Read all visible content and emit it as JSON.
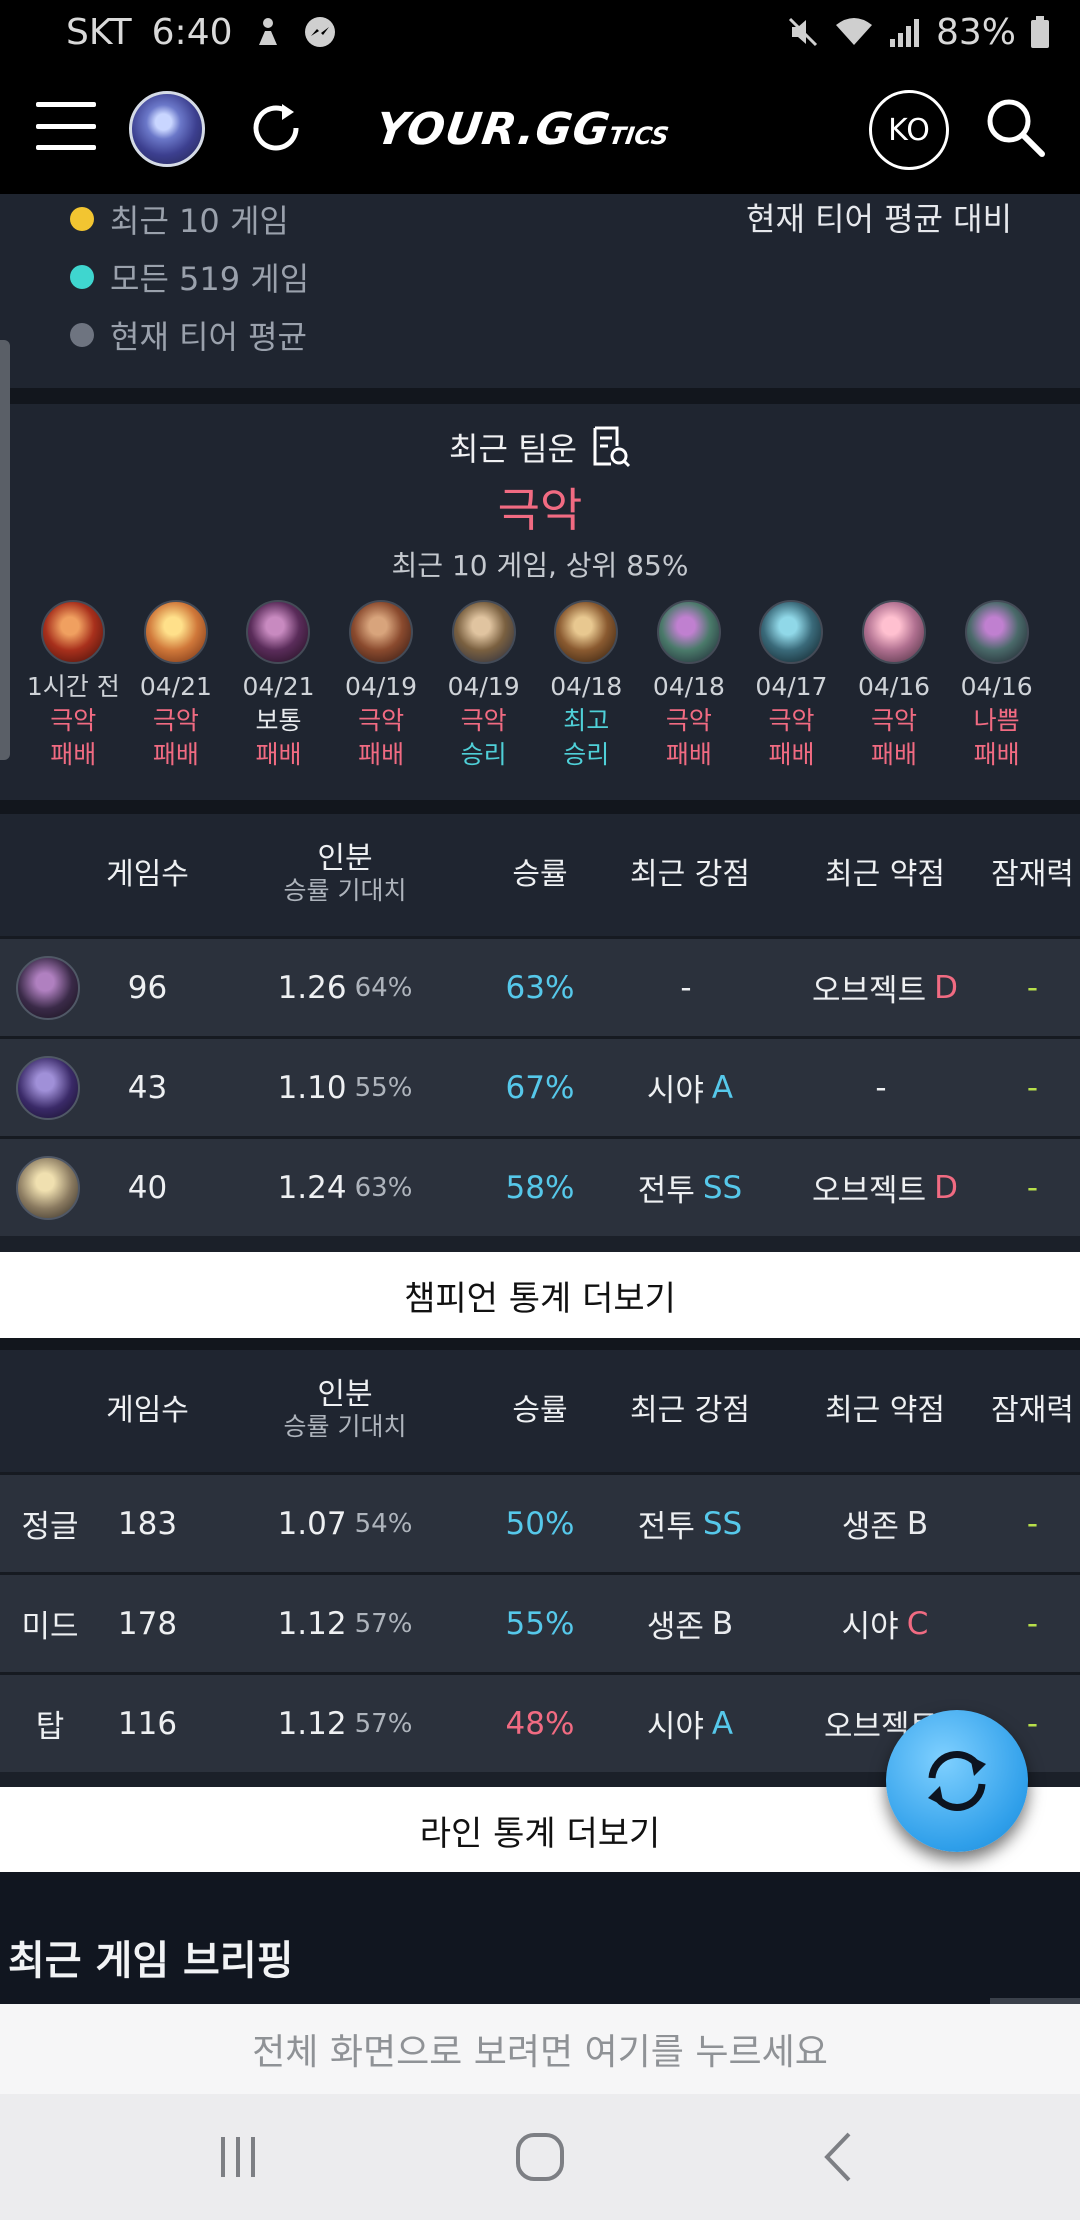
{
  "status_bar": {
    "carrier": "SKT",
    "time": "6:40",
    "battery": "83%"
  },
  "header": {
    "logo_main": "YOUR.GG",
    "logo_suffix": "TICS",
    "lang": "KO"
  },
  "legend": {
    "items": [
      {
        "label": "최근 10 게임",
        "color": "#f2c531"
      },
      {
        "label": "모든 519 게임",
        "color": "#3fd6cf"
      },
      {
        "label": "현재 티어 평균",
        "color": "#6e7480"
      }
    ],
    "compare_label": "현재 티어 평균 대비"
  },
  "team_luck": {
    "title": "최근 팀운",
    "result": "극악",
    "summary": "최근 10 게임, 상위 85%",
    "games": [
      {
        "date": "1시간 전",
        "luck": "극악",
        "luck_color": "red",
        "result": "패배",
        "result_color": "red",
        "icon": "champion-icon-1"
      },
      {
        "date": "04/21",
        "luck": "극악",
        "luck_color": "red",
        "result": "패배",
        "result_color": "red",
        "icon": "champion-icon-2"
      },
      {
        "date": "04/21",
        "luck": "보통",
        "luck_color": "white",
        "result": "패배",
        "result_color": "red",
        "icon": "champion-icon-3"
      },
      {
        "date": "04/19",
        "luck": "극악",
        "luck_color": "red",
        "result": "패배",
        "result_color": "red",
        "icon": "champion-icon-4"
      },
      {
        "date": "04/19",
        "luck": "극악",
        "luck_color": "red",
        "result": "승리",
        "result_color": "cyan",
        "icon": "champion-icon-5"
      },
      {
        "date": "04/18",
        "luck": "최고",
        "luck_color": "cyan",
        "result": "승리",
        "result_color": "cyan",
        "icon": "champion-icon-6"
      },
      {
        "date": "04/18",
        "luck": "극악",
        "luck_color": "red",
        "result": "패배",
        "result_color": "red",
        "icon": "champion-icon-7"
      },
      {
        "date": "04/17",
        "luck": "극악",
        "luck_color": "red",
        "result": "패배",
        "result_color": "red",
        "icon": "champion-icon-8"
      },
      {
        "date": "04/16",
        "luck": "극악",
        "luck_color": "red",
        "result": "패배",
        "result_color": "red",
        "icon": "champion-icon-9"
      },
      {
        "date": "04/16",
        "luck": "나쁨",
        "luck_color": "red",
        "result": "패배",
        "result_color": "red",
        "icon": "champion-icon-10"
      }
    ]
  },
  "table_headers": {
    "games": "게임수",
    "perf": "인분",
    "perf_sub": "승률 기대치",
    "winrate": "승률",
    "strength": "최근 강점",
    "weakness": "최근 약점",
    "potential": "잠재력"
  },
  "champion_stats": {
    "rows": [
      {
        "icon": "champion-icon-akali",
        "games": "96",
        "perf": "1.26",
        "perf_pct": "64%",
        "winrate": "63%",
        "winrate_color": "blue",
        "strength": "-",
        "strength_grade": "",
        "weakness": "오브젝트",
        "weakness_grade": "D",
        "potential": "-"
      },
      {
        "icon": "champion-icon-kassadin",
        "games": "43",
        "perf": "1.10",
        "perf_pct": "55%",
        "winrate": "67%",
        "winrate_color": "blue",
        "strength": "시야",
        "strength_grade": "A",
        "weakness": "-",
        "weakness_grade": "",
        "potential": "-"
      },
      {
        "icon": "champion-icon-3",
        "games": "40",
        "perf": "1.24",
        "perf_pct": "63%",
        "winrate": "58%",
        "winrate_color": "blue",
        "strength": "전투",
        "strength_grade": "SS",
        "weakness": "오브젝트",
        "weakness_grade": "D",
        "potential": "-"
      }
    ],
    "more_label": "챔피언 통계 더보기"
  },
  "lane_stats": {
    "rows": [
      {
        "lane": "정글",
        "games": "183",
        "perf": "1.07",
        "perf_pct": "54%",
        "winrate": "50%",
        "winrate_color": "blue",
        "strength": "전투",
        "strength_grade": "SS",
        "strength_grade_color": "blue",
        "weakness": "생존",
        "weakness_grade": "B",
        "weakness_grade_color": "white",
        "potential": "-"
      },
      {
        "lane": "미드",
        "games": "178",
        "perf": "1.12",
        "perf_pct": "57%",
        "winrate": "55%",
        "winrate_color": "blue",
        "strength": "생존",
        "strength_grade": "B",
        "strength_grade_color": "white",
        "weakness": "시야",
        "weakness_grade": "C",
        "weakness_grade_color": "red",
        "potential": "-"
      },
      {
        "lane": "탑",
        "games": "116",
        "perf": "1.12",
        "perf_pct": "57%",
        "winrate": "48%",
        "winrate_color": "red",
        "strength": "시야",
        "strength_grade": "A",
        "strength_grade_color": "blue",
        "weakness": "오브젝트",
        "weakness_grade": "",
        "weakness_grade_color": "red",
        "potential": "-"
      }
    ],
    "more_label": "라인 통계 더보기"
  },
  "briefing": {
    "title": "최근 게임 브리핑"
  },
  "fullscreen_banner": "전체 화면으로 보려면 여기를 누르세요",
  "colors": {
    "red": "#f16b82",
    "blue": "#56c8ea",
    "cyan": "#4fd0d8",
    "lime": "#b8e04a",
    "white": "#e9ebee"
  }
}
